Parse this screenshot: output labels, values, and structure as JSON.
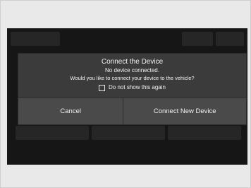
{
  "dialog": {
    "title": "Connect the Device",
    "subtitle": "No device connected.",
    "question": "Would you like to connect your device to the vehicle?",
    "checkbox_label": "Do not show this again",
    "checkbox_checked": false,
    "cancel_label": "Cancel",
    "confirm_label": "Connect New Device"
  },
  "background": {
    "top_left_label": "",
    "top_right_labels": [
      "",
      ""
    ],
    "bottom_labels": [
      "",
      "",
      ""
    ]
  },
  "colors": {
    "screen": "#161616",
    "dialog": "#3b3b3b",
    "button": "#4a4a4a",
    "text": "#f2f2f2"
  }
}
